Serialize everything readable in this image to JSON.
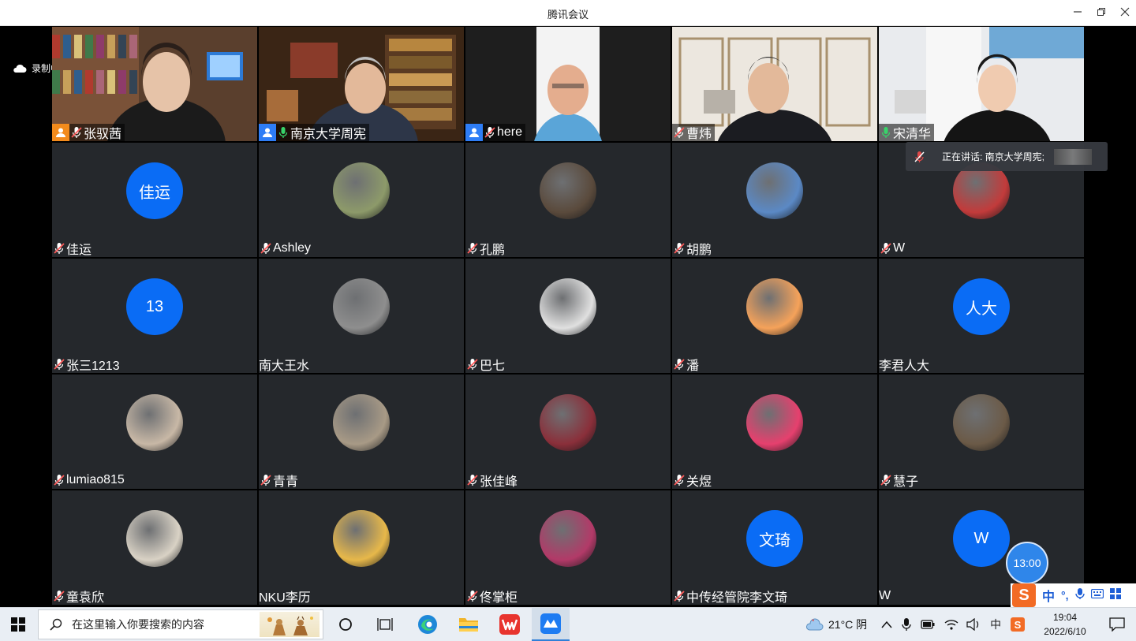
{
  "window": {
    "title": "腾讯会议"
  },
  "recording": {
    "label": "录制中"
  },
  "speaking": {
    "label": "正在讲话: 南京大学周宪;"
  },
  "timer": {
    "value": "13:00"
  },
  "participants": [
    {
      "name": "张驭茜",
      "type": "video",
      "role": "host",
      "muted": true,
      "scene": "library"
    },
    {
      "name": "南京大学周宪",
      "type": "video",
      "role": "cohost",
      "muted": false,
      "speaking": true,
      "scene": "study"
    },
    {
      "name": "here",
      "type": "video",
      "role": "cohost",
      "muted": true,
      "scene": "portrait"
    },
    {
      "name": "曹炜",
      "type": "video",
      "muted": true,
      "scene": "office"
    },
    {
      "name": "宋清华",
      "type": "video",
      "muted": false,
      "scene": "room"
    },
    {
      "name": "佳运",
      "type": "letters",
      "text": "佳运",
      "muted": true
    },
    {
      "name": "Ashley",
      "type": "photo",
      "color": "#8d9a6a",
      "muted": true
    },
    {
      "name": "孔鹏",
      "type": "photo",
      "color": "#5a4a3c",
      "muted": true
    },
    {
      "name": "胡鹏",
      "type": "photo",
      "color": "#5b89c5",
      "muted": true
    },
    {
      "name": "W",
      "type": "photo",
      "color": "#c23b3b",
      "muted": true
    },
    {
      "name": "张三1213",
      "type": "letters",
      "text": "13",
      "muted": true
    },
    {
      "name": "南大王水",
      "type": "photo",
      "color": "#8e8e8e",
      "muted": null
    },
    {
      "name": "巴七",
      "type": "photo",
      "color": "#e0e0e0",
      "muted": true
    },
    {
      "name": "潘",
      "type": "photo",
      "color": "#f5a25a",
      "muted": true
    },
    {
      "name": "李君人大",
      "type": "letters",
      "text": "人大",
      "muted": null
    },
    {
      "name": "lumiao815",
      "type": "photo",
      "color": "#c8b8a6",
      "muted": true
    },
    {
      "name": "青青",
      "type": "photo",
      "color": "#a89a86",
      "muted": true
    },
    {
      "name": "张佳峰",
      "type": "photo",
      "color": "#8a2f3a",
      "muted": true
    },
    {
      "name": "关煜",
      "type": "photo",
      "color": "#e6406e",
      "muted": true
    },
    {
      "name": "慧子",
      "type": "photo",
      "color": "#6b5a47",
      "muted": true
    },
    {
      "name": "童袁欣",
      "type": "photo",
      "color": "#d9d2c5",
      "muted": true
    },
    {
      "name": "NKU李历",
      "type": "photo",
      "color": "#e7b84a",
      "muted": null
    },
    {
      "name": "佟掌柜",
      "type": "photo",
      "color": "#b23a68",
      "muted": true
    },
    {
      "name": "中传经管院李文琦",
      "type": "letters",
      "text": "文琦",
      "muted": true
    },
    {
      "name": "W",
      "type": "letters",
      "text": "W",
      "muted": null
    }
  ],
  "taskbar": {
    "search_placeholder": "在这里输入你要搜索的内容",
    "weather": "21°C 阴",
    "ime_lang": "中",
    "time": "19:04",
    "date": "2022/6/10",
    "icons": [
      "start-icon",
      "search-icon",
      "cortana-icon",
      "task-view-icon",
      "edge-icon",
      "file-explorer-icon",
      "wps-icon",
      "tencent-meeting-icon"
    ]
  },
  "ime_bar": {
    "lang": "中",
    "punct": "°,"
  }
}
